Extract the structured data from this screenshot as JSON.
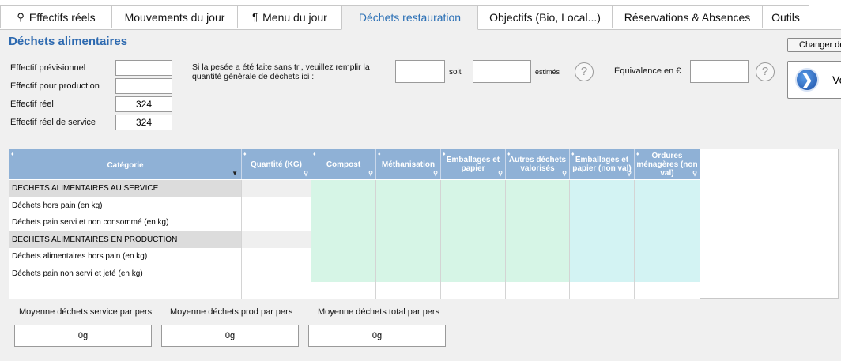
{
  "tabs": [
    {
      "label": "Effectifs réels",
      "icon": "people-icon",
      "active": false
    },
    {
      "label": "Mouvements du jour",
      "icon": "",
      "active": false
    },
    {
      "label": "Menu du jour",
      "icon": "cutlery-icon",
      "active": false
    },
    {
      "label": "Déchets restauration",
      "icon": "",
      "active": true
    },
    {
      "label": "Objectifs (Bio, Local...)",
      "icon": "",
      "active": false
    },
    {
      "label": "Réservations & Absences",
      "icon": "",
      "active": false
    },
    {
      "label": "Outils",
      "icon": "",
      "active": false
    }
  ],
  "section_title": "Déchets alimentaires",
  "effectifs": {
    "previsionnel_label": "Effectif prévisionnel",
    "previsionnel_value": "",
    "production_label": "Effectif pour production",
    "production_value": "",
    "reel_label": "Effectif réel",
    "reel_value": "324",
    "reel_service_label": "Effectif réel de service",
    "reel_service_value": "324"
  },
  "pesee": {
    "instruction": "Si la pesée a été faite sans tri, veuillez remplir la quantité générale de déchets ici :",
    "quantity_value": "",
    "soit_label": "soit",
    "estimate_value": "",
    "estimes_label": "estimés",
    "help_glyph": "?",
    "equivalence_label": "Équivalence en €",
    "equivalence_value": ""
  },
  "buttons": {
    "changer_label": "Changer de",
    "voir_label": "Vo",
    "voir_glyph": "❯"
  },
  "table": {
    "headers": [
      "Catégorie",
      "Quantité (KG)",
      "Compost",
      "Méthanisation",
      "Emballages et papier",
      "Autres déchets valorisés",
      "Emballages et papier (non val)",
      "Ordures ménagères (non val)"
    ],
    "rows": [
      {
        "label": "DECHETS ALIMENTAIRES AU SERVICE",
        "group": true
      },
      {
        "label": "Déchets hors pain (en kg)",
        "group": false
      },
      {
        "label": "Déchets pain servi et non consommé (en kg)",
        "group": false
      },
      {
        "label": "DECHETS ALIMENTAIRES EN PRODUCTION",
        "group": true
      },
      {
        "label": "Déchets alimentaires hors pain (en kg)",
        "group": false
      },
      {
        "label": "Déchets pain non servi et jeté (en kg)",
        "group": false
      },
      {
        "label": "",
        "group": false
      }
    ]
  },
  "moyennes": [
    {
      "label": "Moyenne déchets service par pers",
      "value": "0g"
    },
    {
      "label": "Moyenne déchets prod par pers",
      "value": "0g"
    },
    {
      "label": "Moyenne déchets total par pers",
      "value": "0g"
    }
  ],
  "colors": {
    "accent": "#2e6ab0",
    "header_bg": "#8fb1d6",
    "green_cell": "#d6f5e6",
    "blue_cell": "#d3f3f3",
    "group_row": "#dcdcdc"
  }
}
